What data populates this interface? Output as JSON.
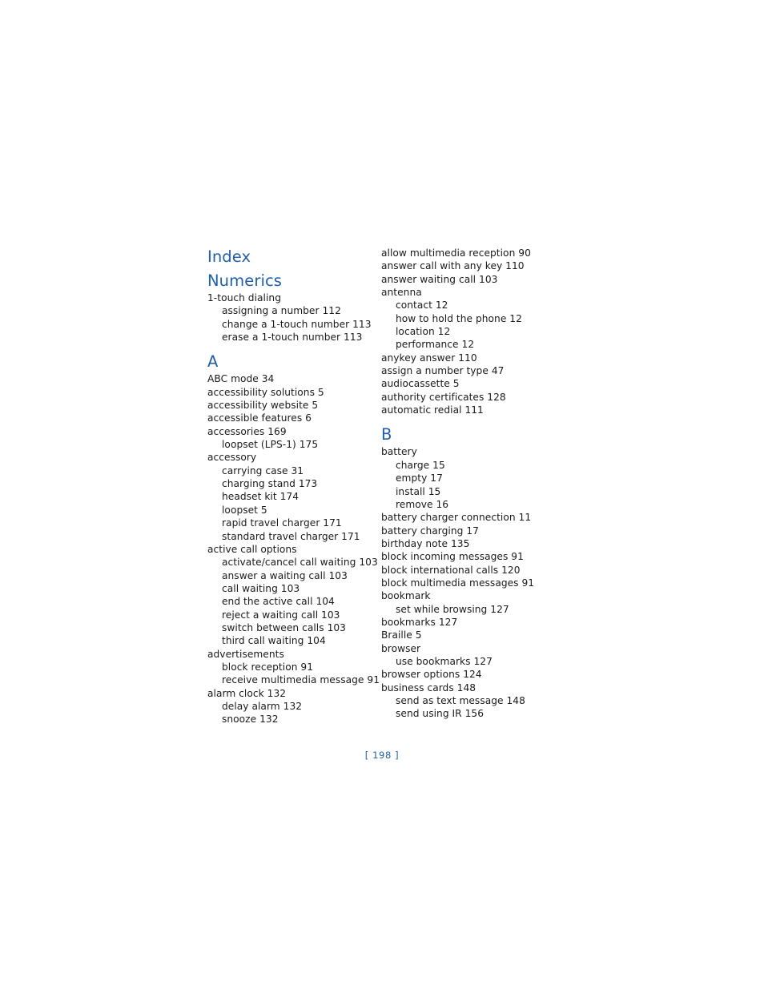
{
  "document": {
    "title": "Index",
    "page_number": "[ 198 ]",
    "heading_color": "#1f5fa9",
    "body_color": "#1a1a1a",
    "background_color": "#ffffff"
  },
  "columns": [
    {
      "id": "left",
      "sections": [
        {
          "heading": "Numerics",
          "entries": [
            {
              "level": 1,
              "text": "1-touch dialing"
            },
            {
              "level": 2,
              "text": "assigning a number 112"
            },
            {
              "level": 2,
              "text": "change a 1-touch number 113"
            },
            {
              "level": 2,
              "text": "erase a 1-touch number 113"
            }
          ]
        },
        {
          "heading": "A",
          "entries": [
            {
              "level": 1,
              "text": "ABC mode 34"
            },
            {
              "level": 1,
              "text": "accessibility solutions 5"
            },
            {
              "level": 1,
              "text": "accessibility website 5"
            },
            {
              "level": 1,
              "text": "accessible features 6"
            },
            {
              "level": 1,
              "text": "accessories 169"
            },
            {
              "level": 2,
              "text": "loopset (LPS-1) 175"
            },
            {
              "level": 1,
              "text": "accessory"
            },
            {
              "level": 2,
              "text": "carrying case 31"
            },
            {
              "level": 2,
              "text": "charging stand 173"
            },
            {
              "level": 2,
              "text": "headset kit 174"
            },
            {
              "level": 2,
              "text": "loopset 5"
            },
            {
              "level": 2,
              "text": "rapid travel charger 171"
            },
            {
              "level": 2,
              "text": "standard travel charger 171"
            },
            {
              "level": 1,
              "text": "active call options"
            },
            {
              "level": 2,
              "text": "activate/cancel call waiting 103"
            },
            {
              "level": 2,
              "text": "answer a waiting call 103"
            },
            {
              "level": 2,
              "text": "call waiting 103"
            },
            {
              "level": 2,
              "text": "end the active call 104"
            },
            {
              "level": 2,
              "text": "reject a waiting call 103"
            },
            {
              "level": 2,
              "text": "switch between calls 103"
            },
            {
              "level": 2,
              "text": "third call waiting 104"
            },
            {
              "level": 1,
              "text": "advertisements"
            },
            {
              "level": 2,
              "text": "block reception 91"
            },
            {
              "level": 2,
              "text": "receive multimedia message 91"
            },
            {
              "level": 1,
              "text": "alarm clock 132"
            },
            {
              "level": 2,
              "text": "delay alarm 132"
            },
            {
              "level": 2,
              "text": "snooze 132"
            }
          ]
        }
      ]
    },
    {
      "id": "right",
      "sections": [
        {
          "heading": "",
          "entries": [
            {
              "level": 1,
              "text": "allow multimedia reception 90"
            },
            {
              "level": 1,
              "text": "answer call with any key 110"
            },
            {
              "level": 1,
              "text": "answer waiting call 103"
            },
            {
              "level": 1,
              "text": "antenna"
            },
            {
              "level": 2,
              "text": "contact 12"
            },
            {
              "level": 2,
              "text": "how to hold the phone 12"
            },
            {
              "level": 2,
              "text": "location 12"
            },
            {
              "level": 2,
              "text": "performance 12"
            },
            {
              "level": 1,
              "text": "anykey answer 110"
            },
            {
              "level": 1,
              "text": "assign a number type 47"
            },
            {
              "level": 1,
              "text": "audiocassette 5"
            },
            {
              "level": 1,
              "text": "authority certificates 128"
            },
            {
              "level": 1,
              "text": "automatic redial 111"
            }
          ]
        },
        {
          "heading": "B",
          "entries": [
            {
              "level": 1,
              "text": "battery"
            },
            {
              "level": 2,
              "text": "charge 15"
            },
            {
              "level": 2,
              "text": "empty 17"
            },
            {
              "level": 2,
              "text": "install 15"
            },
            {
              "level": 2,
              "text": "remove 16"
            },
            {
              "level": 1,
              "text": "battery charger connection 11"
            },
            {
              "level": 1,
              "text": "battery charging 17"
            },
            {
              "level": 1,
              "text": "birthday note 135"
            },
            {
              "level": 1,
              "text": "block incoming messages 91"
            },
            {
              "level": 1,
              "text": "block international calls 120"
            },
            {
              "level": 1,
              "text": "block multimedia messages 91"
            },
            {
              "level": 1,
              "text": "bookmark"
            },
            {
              "level": 2,
              "text": "set while browsing 127"
            },
            {
              "level": 1,
              "text": "bookmarks 127"
            },
            {
              "level": 1,
              "text": "Braille 5"
            },
            {
              "level": 1,
              "text": "browser"
            },
            {
              "level": 2,
              "text": "use bookmarks 127"
            },
            {
              "level": 1,
              "text": "browser options 124"
            },
            {
              "level": 1,
              "text": "business cards 148"
            },
            {
              "level": 2,
              "text": "send as text message 148"
            },
            {
              "level": 2,
              "text": "send using IR 156"
            }
          ]
        }
      ]
    }
  ]
}
